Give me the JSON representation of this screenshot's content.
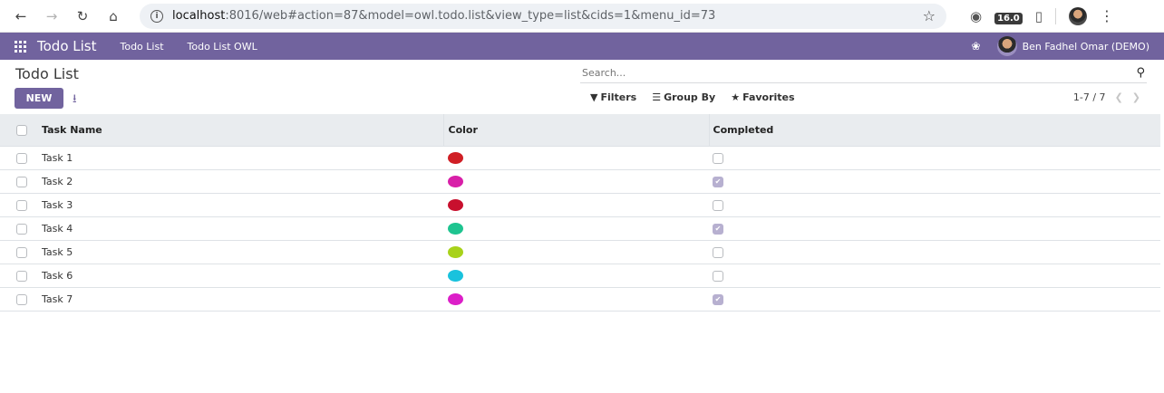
{
  "browser": {
    "url_host": "localhost",
    "url_rest": ":8016/web#action=87&model=owl.todo.list&view_type=list&cids=1&menu_id=73",
    "odoo_version_badge": "16.0",
    "icons": [
      "back-icon",
      "forward-icon",
      "reload-icon",
      "home-icon",
      "site-info-icon",
      "bookmark-star-icon",
      "monkey-extension-icon",
      "odoo-version-extension-icon",
      "extensions-puzzle-icon",
      "profile-avatar-icon",
      "browser-menu-icon"
    ]
  },
  "navbar": {
    "app_name": "Todo List",
    "menu_items": [
      "Todo List",
      "Todo List OWL"
    ],
    "user_name": "Ben Fadhel Omar (DEMO)",
    "color": "#71639e"
  },
  "control_panel": {
    "title": "Todo List",
    "new_button": "NEW",
    "search_placeholder": "Search...",
    "filters_label": "Filters",
    "group_by_label": "Group By",
    "favorites_label": "Favorites",
    "pager_value": "1-7 / 7"
  },
  "table": {
    "headers": {
      "name": "Task Name",
      "color": "Color",
      "completed": "Completed"
    },
    "rows": [
      {
        "name": "Task 1",
        "color": "#d01f25",
        "completed": false
      },
      {
        "name": "Task 2",
        "color": "#d81fa8",
        "completed": true
      },
      {
        "name": "Task 3",
        "color": "#c8102e",
        "completed": false
      },
      {
        "name": "Task 4",
        "color": "#1fc490",
        "completed": true
      },
      {
        "name": "Task 5",
        "color": "#a8d21a",
        "completed": false
      },
      {
        "name": "Task 6",
        "color": "#19c2dd",
        "completed": false
      },
      {
        "name": "Task 7",
        "color": "#dc1fc8",
        "completed": true
      }
    ]
  }
}
